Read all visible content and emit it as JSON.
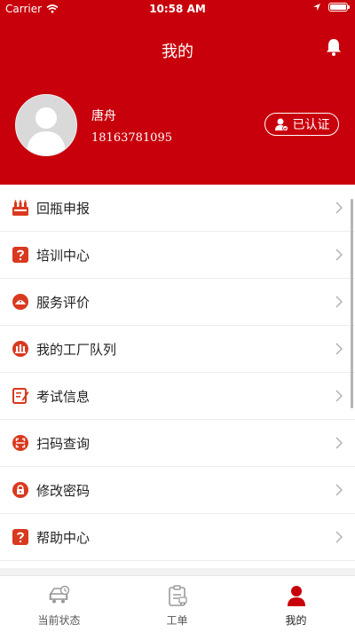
{
  "status_bar": {
    "carrier": "Carrier",
    "time": "10:58 AM"
  },
  "header": {
    "title": "我的"
  },
  "profile": {
    "name": "唐舟",
    "phone": "18163781095",
    "verified_label": "已认证"
  },
  "colors": {
    "brand": "#c8000b",
    "icon_accent": "#d9391f"
  },
  "menu": [
    {
      "label": "回瓶申报",
      "icon": "bottles-icon"
    },
    {
      "label": "培训中心",
      "icon": "question-icon"
    },
    {
      "label": "服务评价",
      "icon": "rating-icon"
    },
    {
      "label": "我的工厂队列",
      "icon": "factory-queue-icon"
    },
    {
      "label": "考试信息",
      "icon": "exam-edit-icon"
    },
    {
      "label": "扫码查询",
      "icon": "scan-icon"
    },
    {
      "label": "修改密码",
      "icon": "lock-icon"
    },
    {
      "label": "帮助中心",
      "icon": "help-icon"
    }
  ],
  "tabbar": [
    {
      "label": "当前状态",
      "icon": "truck-status-icon",
      "active": false
    },
    {
      "label": "工单",
      "icon": "work-order-icon",
      "active": false
    },
    {
      "label": "我的",
      "icon": "person-icon",
      "active": true
    }
  ]
}
